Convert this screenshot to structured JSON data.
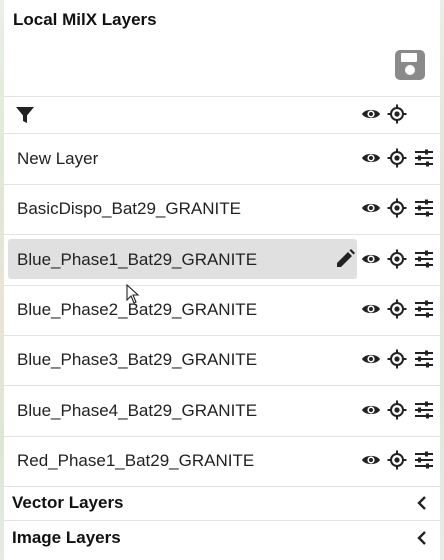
{
  "panel": {
    "title": "Local MilX Layers",
    "save_icon": "save-icon",
    "filter_icon": "filter-icon"
  },
  "layers": [
    {
      "label": "New Layer",
      "selected": false
    },
    {
      "label": "BasicDispo_Bat29_GRANITE",
      "selected": false
    },
    {
      "label": "Blue_Phase1_Bat29_GRANITE",
      "selected": true
    },
    {
      "label": "Blue_Phase2_Bat29_GRANITE",
      "selected": false
    },
    {
      "label": "Blue_Phase3_Bat29_GRANITE",
      "selected": false
    },
    {
      "label": "Blue_Phase4_Bat29_GRANITE",
      "selected": false
    },
    {
      "label": "Red_Phase1_Bat29_GRANITE",
      "selected": false
    }
  ],
  "sections": {
    "vector": "Vector Layers",
    "image": "Image Layers"
  },
  "colors": {
    "icon": "#222222",
    "save_icon": "#8a8a8a",
    "selected_row": "#e0e0e0"
  }
}
